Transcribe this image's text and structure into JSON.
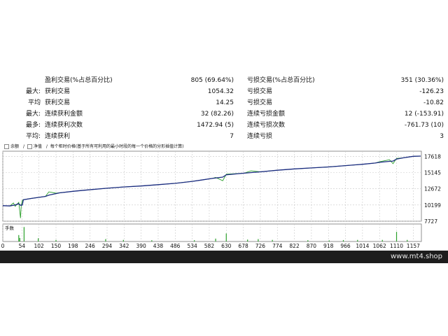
{
  "stats": {
    "rows": [
      {
        "label": "",
        "name1": "盈利交易(%占总百分比)",
        "value1": "805 (69.64%)",
        "name2": "亏损交易(%占总百分比)",
        "value2": "351 (30.36%)"
      },
      {
        "label": "最大:",
        "name1": "获利交易",
        "value1": "1054.32",
        "name2": "亏损交易",
        "value2": "-126.23"
      },
      {
        "label": "平均",
        "name1": "获利交易",
        "value1": "14.25",
        "name2": "亏损交易",
        "value2": "-10.82"
      },
      {
        "label": "最大:",
        "name1": "连续获利金额",
        "value1": "32 (82.26)",
        "name2": "连续亏损金额",
        "value2": "12 (-153.91)"
      },
      {
        "label": "最多:",
        "name1": "连续获利次数",
        "value1": "1472.94 (5)",
        "name2": "连续亏损次数",
        "value2": "-761.73 (10)"
      },
      {
        "label": "平均:",
        "name1": "连续获利",
        "value1": "7",
        "name2": "连续亏损",
        "value2": "3"
      }
    ]
  },
  "legend": {
    "item1": "余额",
    "item2": "净值",
    "note": "每个柜时价格(基于所有可利用的最小时段的每一个价格的分形插值计算)"
  },
  "volume_label": "手数",
  "watermark": "www.mt4.shop",
  "colors": {
    "balance": "#1a2a80",
    "equity": "#2ca02c",
    "volume": "#2ca02c",
    "grid": "#c8c8c8"
  },
  "chart_data": {
    "type": "line",
    "x_ticks": [
      0,
      54,
      102,
      150,
      198,
      246,
      294,
      342,
      390,
      438,
      486,
      534,
      582,
      630,
      678,
      726,
      774,
      822,
      870,
      918,
      966,
      1014,
      1062,
      1110,
      1157
    ],
    "y_ticks": [
      17618,
      15145,
      12672,
      10199,
      7727
    ],
    "xlim": [
      0,
      1180
    ],
    "ylim": [
      7727,
      18400
    ],
    "series": [
      {
        "name": "余额",
        "values": [
          [
            0,
            10100
          ],
          [
            20,
            10050
          ],
          [
            35,
            10200
          ],
          [
            45,
            10400
          ],
          [
            50,
            10150
          ],
          [
            55,
            10200
          ],
          [
            58,
            11000
          ],
          [
            80,
            11200
          ],
          [
            120,
            11500
          ],
          [
            130,
            11700
          ],
          [
            160,
            12050
          ],
          [
            200,
            12300
          ],
          [
            250,
            12550
          ],
          [
            294,
            12750
          ],
          [
            340,
            12950
          ],
          [
            390,
            13100
          ],
          [
            438,
            13300
          ],
          [
            486,
            13500
          ],
          [
            534,
            13800
          ],
          [
            560,
            14000
          ],
          [
            590,
            14250
          ],
          [
            620,
            14450
          ],
          [
            630,
            14800
          ],
          [
            680,
            15050
          ],
          [
            726,
            15250
          ],
          [
            774,
            15500
          ],
          [
            822,
            15700
          ],
          [
            870,
            15850
          ],
          [
            918,
            16000
          ],
          [
            966,
            16200
          ],
          [
            1014,
            16400
          ],
          [
            1050,
            16600
          ],
          [
            1062,
            16700
          ],
          [
            1090,
            16850
          ],
          [
            1100,
            16900
          ],
          [
            1110,
            17200
          ],
          [
            1130,
            17400
          ],
          [
            1157,
            17618
          ],
          [
            1178,
            17650
          ]
        ]
      },
      {
        "name": "净值",
        "values": [
          [
            0,
            10100
          ],
          [
            20,
            10050
          ],
          [
            30,
            10500
          ],
          [
            35,
            10000
          ],
          [
            45,
            10600
          ],
          [
            50,
            8200
          ],
          [
            52,
            10200
          ],
          [
            55,
            10900
          ],
          [
            58,
            11000
          ],
          [
            80,
            11200
          ],
          [
            120,
            11500
          ],
          [
            130,
            12200
          ],
          [
            150,
            12000
          ],
          [
            160,
            12050
          ],
          [
            200,
            12300
          ],
          [
            250,
            12550
          ],
          [
            294,
            12750
          ],
          [
            340,
            12950
          ],
          [
            390,
            13100
          ],
          [
            438,
            13300
          ],
          [
            486,
            13500
          ],
          [
            534,
            13800
          ],
          [
            560,
            14000
          ],
          [
            590,
            14250
          ],
          [
            600,
            14400
          ],
          [
            620,
            13900
          ],
          [
            630,
            14900
          ],
          [
            680,
            15050
          ],
          [
            700,
            15400
          ],
          [
            726,
            15250
          ],
          [
            774,
            15500
          ],
          [
            822,
            15700
          ],
          [
            870,
            15850
          ],
          [
            918,
            16000
          ],
          [
            966,
            16200
          ],
          [
            1014,
            16400
          ],
          [
            1050,
            16600
          ],
          [
            1062,
            16800
          ],
          [
            1090,
            17100
          ],
          [
            1100,
            16500
          ],
          [
            1110,
            17300
          ],
          [
            1130,
            17400
          ],
          [
            1157,
            17618
          ],
          [
            1178,
            17650
          ]
        ]
      }
    ],
    "volume": [
      [
        45,
        4.0
      ],
      [
        48,
        2.2
      ],
      [
        60,
        9.0
      ],
      [
        100,
        2.0
      ],
      [
        150,
        1.0
      ],
      [
        290,
        1.5
      ],
      [
        340,
        1.0
      ],
      [
        420,
        0.8
      ],
      [
        540,
        0.8
      ],
      [
        600,
        1.8
      ],
      [
        630,
        5.0
      ],
      [
        690,
        1.2
      ],
      [
        720,
        1.5
      ],
      [
        760,
        1.0
      ],
      [
        860,
        0.8
      ],
      [
        920,
        0.7
      ],
      [
        960,
        0.9
      ],
      [
        1000,
        1.0
      ],
      [
        1070,
        1.0
      ],
      [
        1110,
        6.0
      ],
      [
        1140,
        1.0
      ]
    ]
  }
}
